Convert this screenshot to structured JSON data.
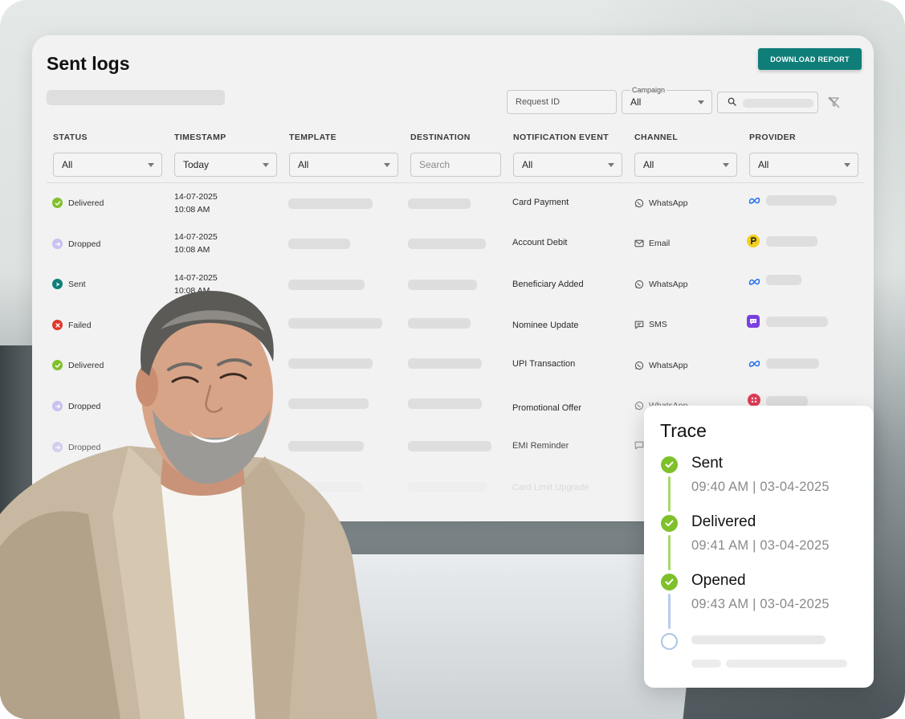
{
  "page": {
    "title": "Sent logs"
  },
  "toolbar": {
    "download_label": "DOWNLOAD REPORT",
    "request_id_placeholder": "Request ID",
    "campaign_label": "Campaign",
    "campaign_value": "All"
  },
  "columns": [
    {
      "header": "STATUS",
      "filter": "All"
    },
    {
      "header": "TIMESTAMP",
      "filter": "Today"
    },
    {
      "header": "TEMPLATE",
      "filter": "All"
    },
    {
      "header": "DESTINATION",
      "filter": "Search"
    },
    {
      "header": "NOTIFICATION EVENT",
      "filter": "All"
    },
    {
      "header": "CHANNEL",
      "filter": "All"
    },
    {
      "header": "PROVIDER",
      "filter": "All"
    }
  ],
  "rows": [
    {
      "status": "Delivered",
      "date": "14-07-2025",
      "time": "10:08 AM",
      "event": "Card Payment",
      "channel": "WhatsApp"
    },
    {
      "status": "Dropped",
      "date": "14-07-2025",
      "time": "10:08 AM",
      "event": "Account Debit",
      "channel": "Email"
    },
    {
      "status": "Sent",
      "date": "14-07-2025",
      "time": "10:08 AM",
      "event": "Beneficiary Added",
      "channel": "WhatsApp"
    },
    {
      "status": "Failed",
      "event": "Nominee Update",
      "channel": "SMS"
    },
    {
      "status": "Delivered",
      "event": "UPI Transaction",
      "channel": "WhatsApp"
    },
    {
      "status": "Dropped",
      "event": "Promotional Offer",
      "channel": "WhatsApp"
    },
    {
      "status": "Dropped",
      "event": "EMI Reminder"
    },
    {
      "event": "Card Limit Upgrade"
    }
  ],
  "colors": {
    "accent": "#0f7e79",
    "delivered": "#7ec12a",
    "dropped": "#b9b4ec",
    "sent": "#0f7e79",
    "failed": "#e0362c"
  },
  "trace": {
    "title": "Trace",
    "steps": [
      {
        "name": "Sent",
        "time": "09:40 AM | 03-04-2025"
      },
      {
        "name": "Delivered",
        "time": "09:41 AM | 03-04-2025"
      },
      {
        "name": "Opened",
        "time": "09:43 AM | 03-04-2025"
      }
    ]
  }
}
